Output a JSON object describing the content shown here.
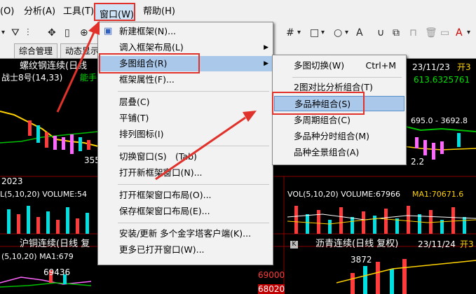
{
  "menubar": {
    "items": [
      {
        "label": "(O)"
      },
      {
        "label": "分析(A)"
      },
      {
        "label": "工具(T)"
      },
      {
        "label": "窗口(W)"
      },
      {
        "label": "帮助(H)"
      }
    ]
  },
  "tabs": [
    {
      "label": "综合管理"
    },
    {
      "label": "动态显示"
    }
  ],
  "charts": {
    "top_left": {
      "title": "螺纹钢连续(日线",
      "indicator": "战士8号(14,33)",
      "indicator_partial": "能手",
      "year": "2023",
      "vol_label": "L(5,10,20) VOLUME:54",
      "price_partial": "355"
    },
    "top_right": {
      "date": "23/11/23",
      "open_partial": "开3",
      "value": "613.6325761",
      "range_text": "695.0 - 3692.8",
      "small_value": "2.2",
      "vol_label": "VOL(5,10,20) VOLUME:67966",
      "ma_label": "MA1:70671.6"
    },
    "bottom_left": {
      "title": "沪铜连续(日线 复",
      "ma_label": "(5,10,20) MA1:679",
      "price": "69436",
      "axis1": "69000",
      "axis2": "68020"
    },
    "bottom_right": {
      "tag": "K",
      "title": "沥青连续(日线 复权)",
      "date": "23/11/24",
      "open_partial": "开3",
      "price": "3872"
    }
  },
  "window_menu": {
    "items": [
      {
        "label": "新建框架(N)..."
      },
      {
        "label": "调入框架布局(L)"
      },
      {
        "label": "多图组合(R)"
      },
      {
        "label": "框架属性(F)..."
      },
      {
        "label": "层叠(C)"
      },
      {
        "label": "平铺(T)"
      },
      {
        "label": "排列图标(I)"
      },
      {
        "label": "切换窗口(S)",
        "shortcut": "(Tab)"
      },
      {
        "label": "打开新框架窗口(N)..."
      },
      {
        "label": "打开框架窗口布局(O)..."
      },
      {
        "label": "保存框架窗口布局(E)..."
      },
      {
        "label": "安装/更新 多个金字塔客户端(K)..."
      },
      {
        "label": "更多已打开窗口(W)..."
      }
    ]
  },
  "submenu": {
    "items": [
      {
        "label": "多图切换(W)",
        "shortcut": "Ctrl+M"
      },
      {
        "label": "2图对比分析组合(T)"
      },
      {
        "label": "多品种组合(S)"
      },
      {
        "label": "多周期组合(C)"
      },
      {
        "label": "多品种分时组合(M)"
      },
      {
        "label": "品种全景组合(A)"
      }
    ]
  },
  "colors": {
    "annotation": "#e0322b",
    "highlight": "#a9c8ea",
    "chart_bg": "#000000",
    "up": "#ff3b3b",
    "down": "#00e0e0"
  }
}
